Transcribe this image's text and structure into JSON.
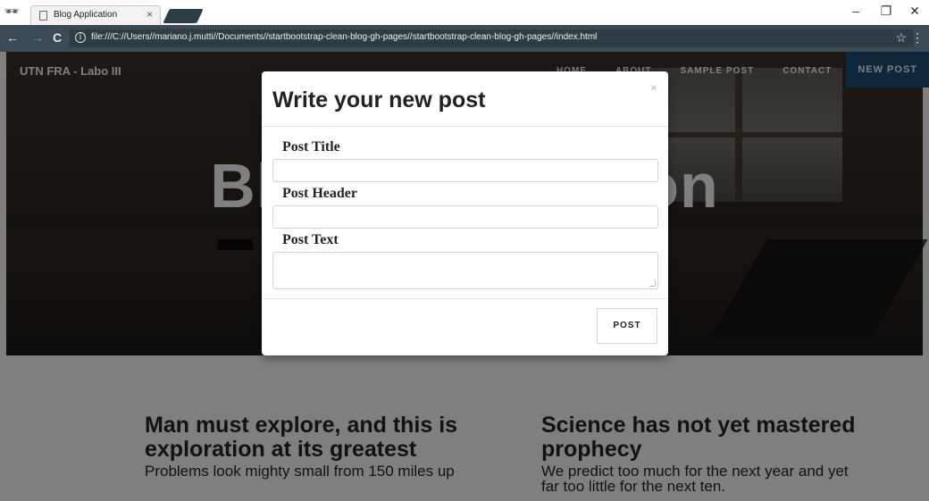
{
  "browser": {
    "tab_title": "Blog Application",
    "tab_close": "×",
    "url": "file:///C://Users//mariano.j.mutti//Documents//startbootstrap-clean-blog-gh-pages//startbootstrap-clean-blog-gh-pages//index.html",
    "window_controls": {
      "minimize": "–",
      "restore": "❐",
      "close": "✕"
    },
    "nav": {
      "back": "←",
      "forward": "→",
      "reload": "C"
    },
    "info": "i",
    "star": "☆",
    "menu": "⋮",
    "incognito": "🕶"
  },
  "site": {
    "brand": "UTN FRA - Labo III",
    "nav": [
      "HOME",
      "ABOUT",
      "SAMPLE POST",
      "CONTACT"
    ],
    "cta": "NEW POST",
    "hero_title": "Blog Application",
    "posts": [
      {
        "title": "Man must explore, and this is exploration at its greatest",
        "subtitle": "Problems look mighty small from 150 miles up"
      },
      {
        "title": "Science has not yet mastered prophecy",
        "subtitle": "We predict too much for the next year and yet far too little for the next ten."
      }
    ]
  },
  "modal": {
    "title": "Write your new post",
    "close": "×",
    "fields": [
      {
        "label": "Post Title",
        "value": ""
      },
      {
        "label": "Post Header",
        "value": ""
      },
      {
        "label": "Post Text",
        "value": ""
      }
    ],
    "submit": "POST"
  }
}
